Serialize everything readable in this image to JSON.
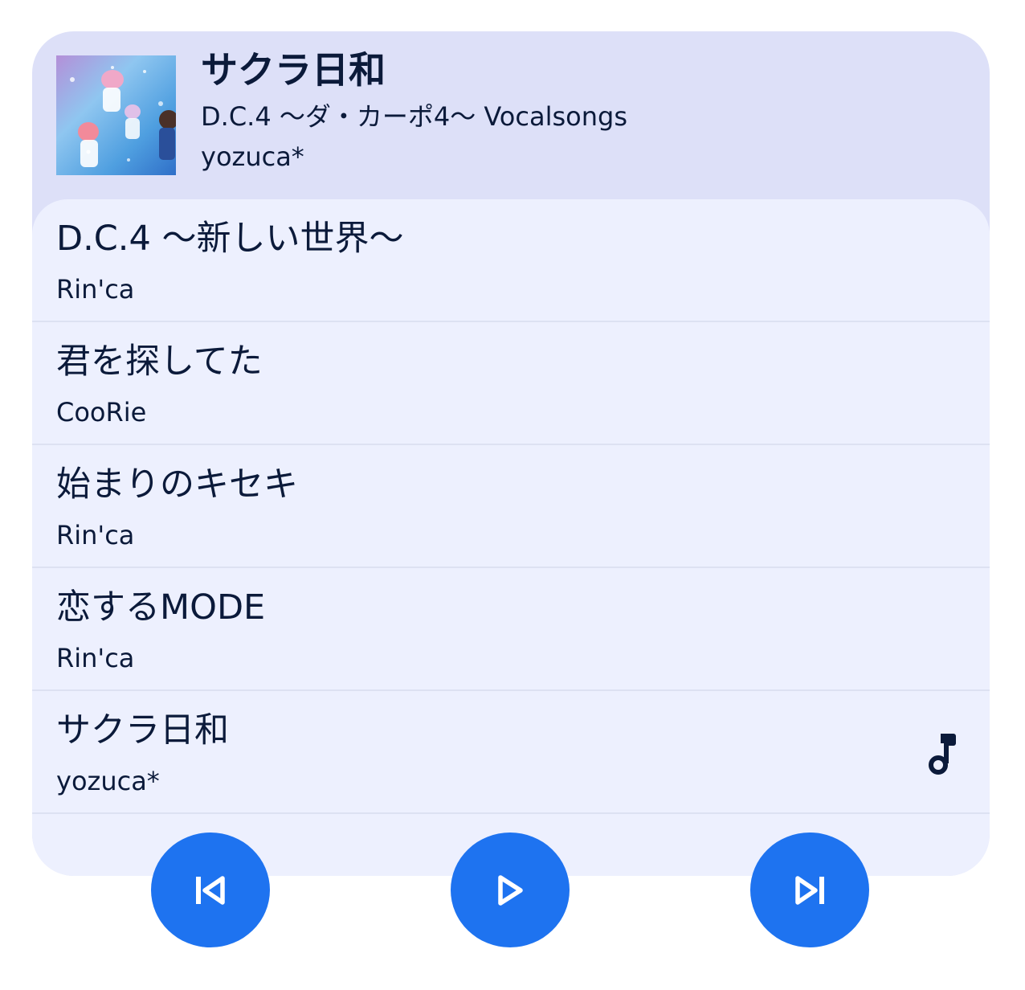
{
  "now_playing": {
    "title": "サクラ日和",
    "album": "D.C.4 〜ダ・カーポ4〜 Vocalsongs",
    "artist": "yozuca*",
    "album_art_icon": "album-cover-image"
  },
  "tracks": [
    {
      "title": "D.C.4 〜新しい世界〜",
      "artist": "Rin'ca",
      "playing": false
    },
    {
      "title": "君を探してた",
      "artist": "CooRie",
      "playing": false
    },
    {
      "title": "始まりのキセキ",
      "artist": "Rin'ca",
      "playing": false
    },
    {
      "title": "恋するMODE",
      "artist": "Rin'ca",
      "playing": false
    },
    {
      "title": "サクラ日和",
      "artist": "yozuca*",
      "playing": true,
      "indicator_icon": "music-note-icon"
    }
  ],
  "controls": {
    "previous_icon": "skip-previous-icon",
    "play_icon": "play-icon",
    "next_icon": "skip-next-icon"
  },
  "colors": {
    "header_bg": "#dde0f8",
    "list_bg": "#edf0fe",
    "button_bg": "#1e73f0",
    "text": "#0b1a3a"
  }
}
